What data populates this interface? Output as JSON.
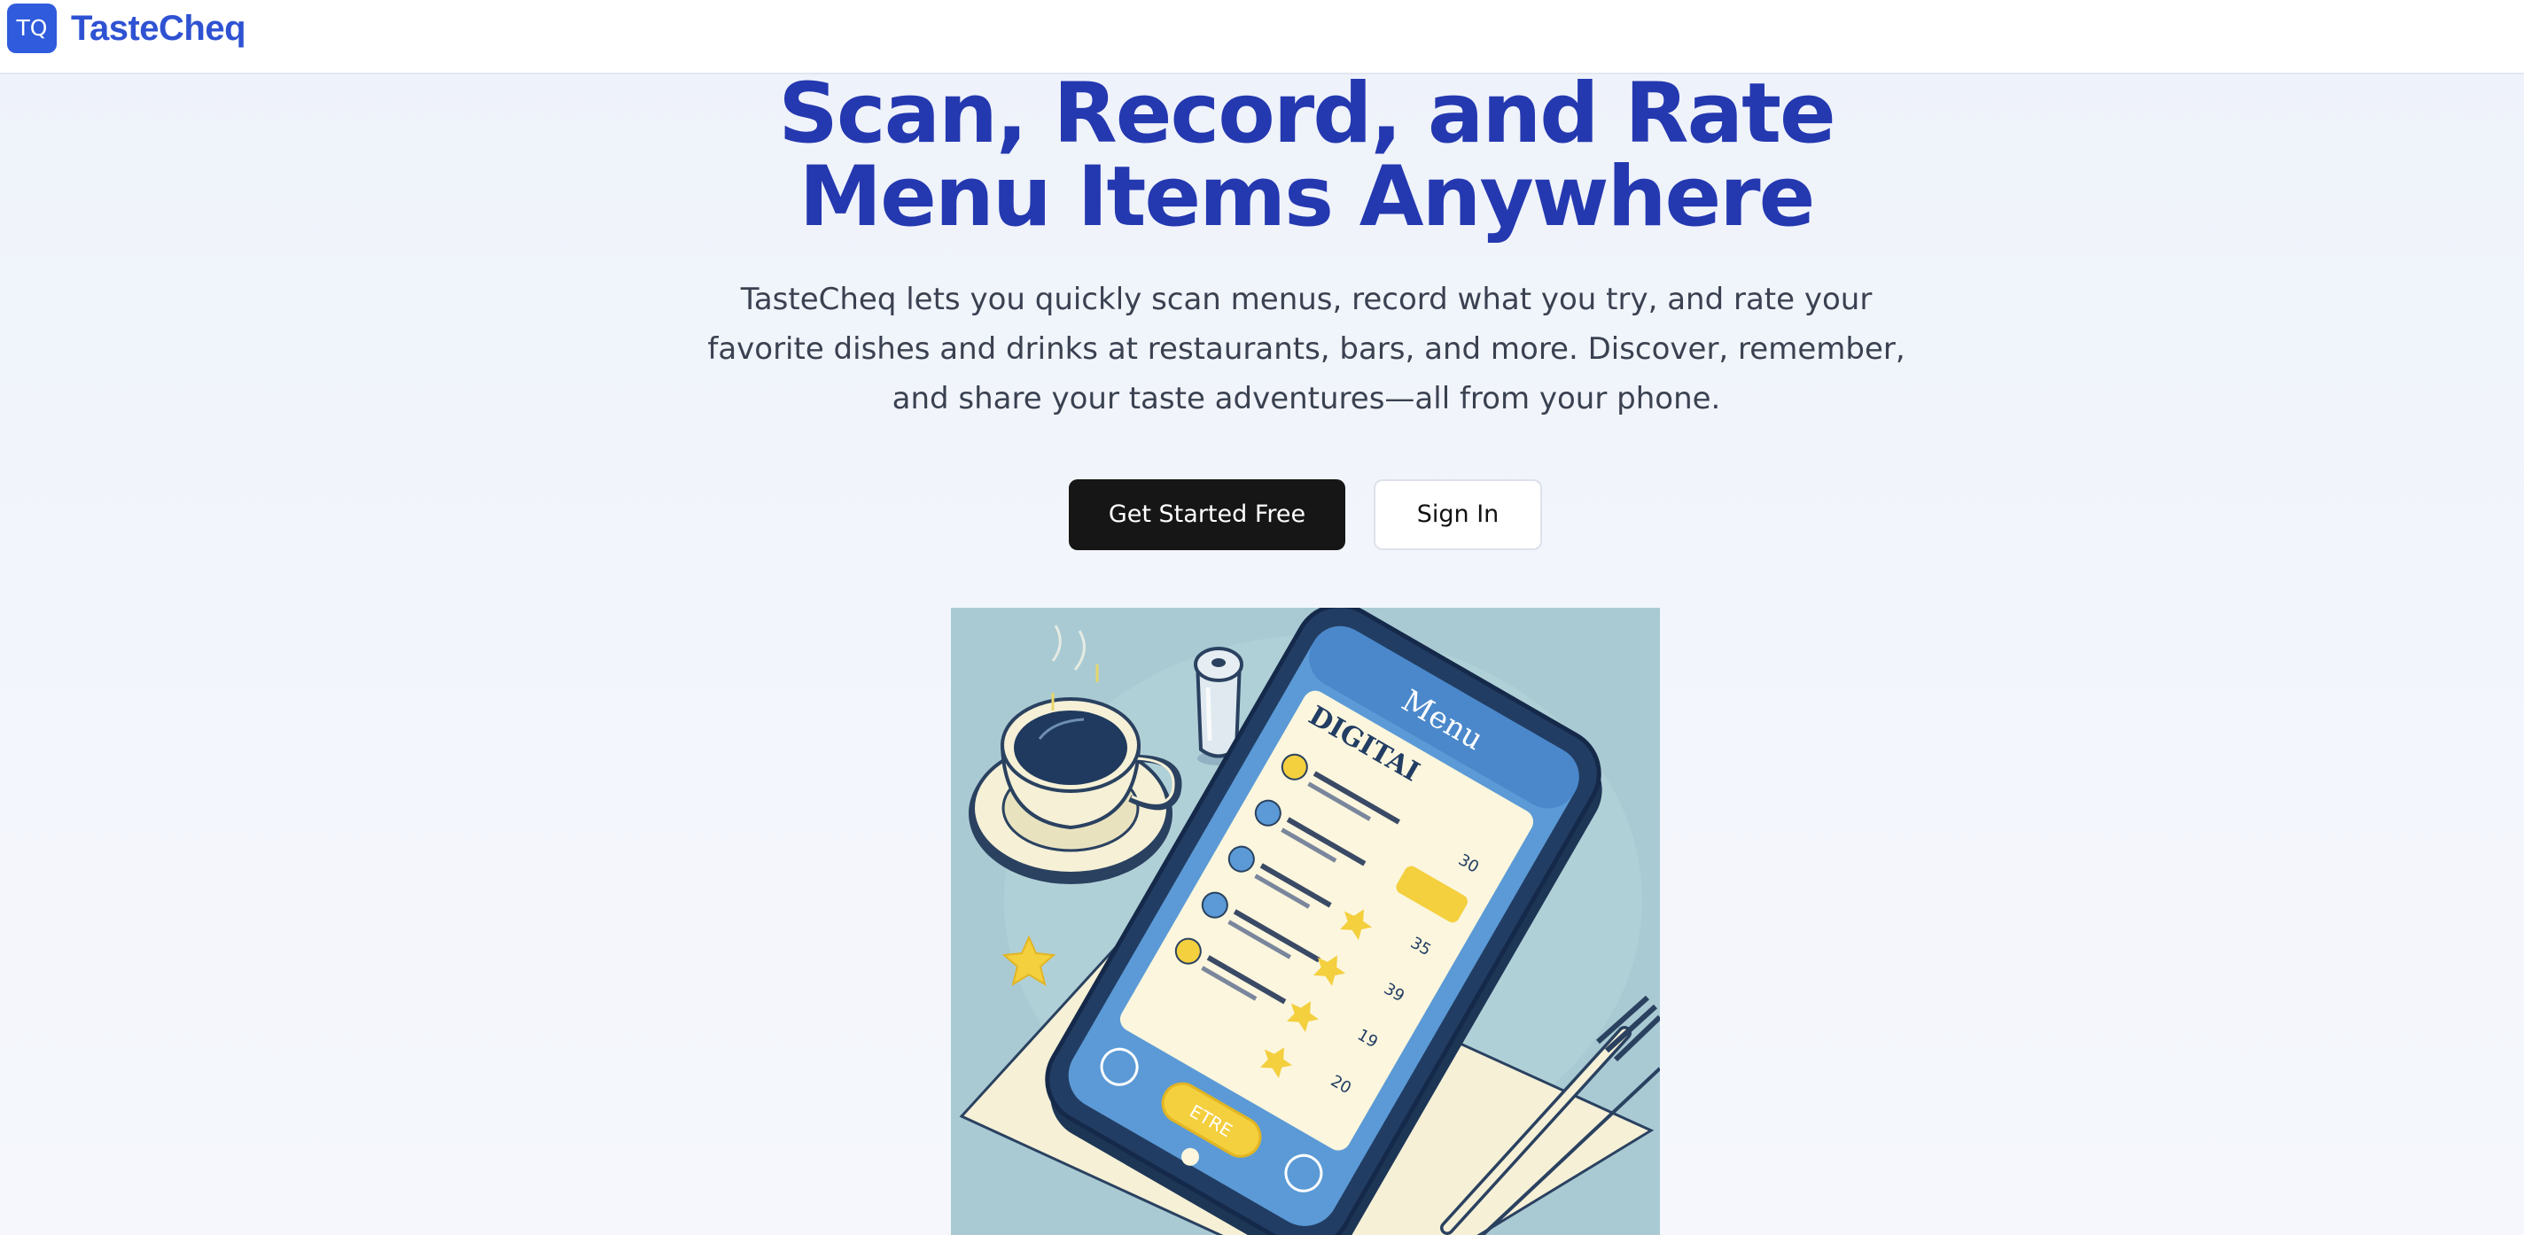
{
  "header": {
    "logo_initials": "TQ",
    "brand_name": "TasteCheq"
  },
  "hero": {
    "title_line1": "Scan, Record, and Rate",
    "title_line2": "Menu Items Anywhere",
    "description": "TasteCheq lets you quickly scan menus, record what you try, and rate your favorite dishes and drinks at restaurants, bars, and more. Discover, remember, and share your taste adventures—all from your phone.",
    "primary_cta": "Get Started Free",
    "secondary_cta": "Sign In"
  },
  "illustration": {
    "screen_title": "Menu",
    "screen_heading": "DIGITAI",
    "screen_button": "ETRE",
    "prices": [
      "30",
      "35",
      "39",
      "19",
      "20"
    ]
  },
  "colors": {
    "brand_blue": "#2e52d2",
    "title_blue": "#2438b0",
    "primary_button": "#161616",
    "illustration_bg": "#a9cad3"
  }
}
